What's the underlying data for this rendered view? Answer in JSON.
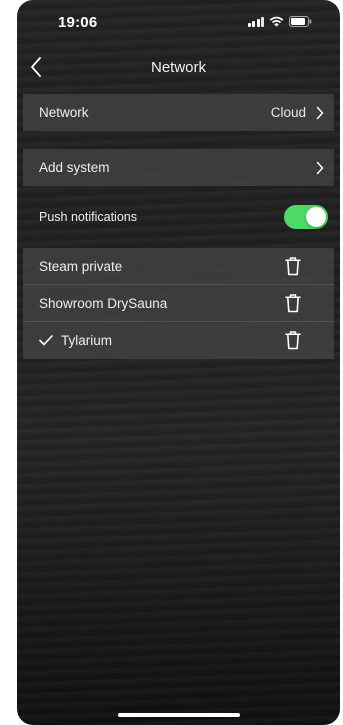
{
  "status_bar": {
    "time": "19:06"
  },
  "nav": {
    "title": "Network"
  },
  "settings": {
    "network_label": "Network",
    "network_value": "Cloud",
    "add_system_label": "Add system",
    "push_label": "Push notifications",
    "push_enabled": true
  },
  "systems": [
    {
      "name": "Steam private",
      "selected": false
    },
    {
      "name": "Showroom DrySauna",
      "selected": false
    },
    {
      "name": "Tylarium",
      "selected": true
    }
  ],
  "colors": {
    "toggle_on": "#4cd964",
    "row_background": "#464648",
    "text": "#eeeeee"
  },
  "icons": {
    "back": "chevron-left-icon",
    "disclosure": "chevron-right-icon",
    "delete": "trash-icon",
    "selected": "checkmark-icon"
  }
}
